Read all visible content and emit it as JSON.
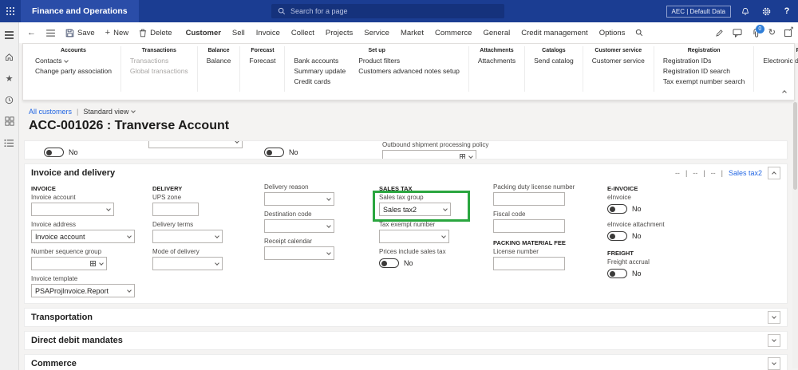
{
  "topbar": {
    "app_title": "Finance and Operations",
    "search_placeholder": "Search for a page",
    "environment_badge": "AEC | Default Data",
    "help_glyph": "?"
  },
  "icons": {
    "back": "←",
    "new_plus": "+",
    "refresh": "↻",
    "popout_arrow": "↗",
    "star": "★"
  },
  "command_bar": {
    "save": "Save",
    "new": "New",
    "delete": "Delete",
    "tabs": [
      "Customer",
      "Sell",
      "Invoice",
      "Collect",
      "Projects",
      "Service",
      "Market",
      "Commerce",
      "General",
      "Credit management",
      "Options"
    ],
    "badge_count": "0"
  },
  "ribbon": {
    "groups": [
      {
        "title": "Accounts",
        "items": [
          "Contacts",
          "Change party association"
        ]
      },
      {
        "title": "Transactions",
        "items": [
          "Transactions",
          "Global transactions"
        ]
      },
      {
        "title": "Balance",
        "items": [
          "Balance"
        ]
      },
      {
        "title": "Forecast",
        "items": [
          "Forecast"
        ]
      },
      {
        "title": "Set up",
        "col1": [
          "Bank accounts",
          "Summary update",
          "Credit cards"
        ],
        "col2": [
          "Product filters",
          "Customers advanced notes setup"
        ]
      },
      {
        "title": "Attachments",
        "items": [
          "Attachments"
        ]
      },
      {
        "title": "Catalogs",
        "items": [
          "Send catalog"
        ]
      },
      {
        "title": "Customer service",
        "items": [
          "Customer service"
        ]
      },
      {
        "title": "Registration",
        "items": [
          "Registration IDs",
          "Registration ID search",
          "Tax exempt number search"
        ]
      },
      {
        "title": "Properties",
        "items": [
          "Electronic document properties"
        ]
      }
    ]
  },
  "page": {
    "breadcrumb_link": "All customers",
    "separator": "|",
    "view_selector": "Standard view",
    "title": "ACC-001026 : Tranverse Account"
  },
  "partial": {
    "toggle1_label": "No",
    "toggle2_label": "No",
    "outbound_label": "Outbound shipment processing policy"
  },
  "invoice_delivery": {
    "title": "Invoice and delivery",
    "dash": "--",
    "separator": "|",
    "summary_link": "Sales tax2",
    "invoice_group": {
      "title": "INVOICE",
      "invoice_account_label": "Invoice account",
      "invoice_address_label": "Invoice address",
      "invoice_address_value": "Invoice account",
      "number_sequence_label": "Number sequence group",
      "invoice_template_label": "Invoice template",
      "invoice_template_value": "PSAProjInvoice.Report"
    },
    "delivery_group": {
      "title": "DELIVERY",
      "ups_zone_label": "UPS zone",
      "delivery_terms_label": "Delivery terms",
      "mode_of_delivery_label": "Mode of delivery"
    },
    "misc_group": {
      "delivery_reason_label": "Delivery reason",
      "destination_code_label": "Destination code",
      "receipt_calendar_label": "Receipt calendar"
    },
    "sales_tax_group": {
      "title": "SALES TAX",
      "sales_tax_group_label": "Sales tax group",
      "sales_tax_group_value": "Sales tax2",
      "tax_exempt_label": "Tax exempt number",
      "prices_include_label": "Prices include sales tax",
      "prices_include_value": "No"
    },
    "packing_group": {
      "packing_duty_label": "Packing duty license number",
      "fiscal_code_label": "Fiscal code",
      "packing_material_title": "PACKING MATERIAL FEE",
      "license_number_label": "License number"
    },
    "einvoice_group": {
      "title": "E-INVOICE",
      "einvoice_label": "eInvoice",
      "einvoice_value": "No",
      "einvoice_attachment_label": "eInvoice attachment",
      "einvoice_attachment_value": "No",
      "freight_title": "FREIGHT",
      "freight_accrual_label": "Freight accrual",
      "freight_accrual_value": "No"
    }
  },
  "collapsed_sections": [
    "Transportation",
    "Direct debit mandates",
    "Commerce"
  ],
  "colors": {
    "topbar_blue": "#1b3d92",
    "link_blue": "#2266e3",
    "annotation_green": "#2aa63f"
  }
}
